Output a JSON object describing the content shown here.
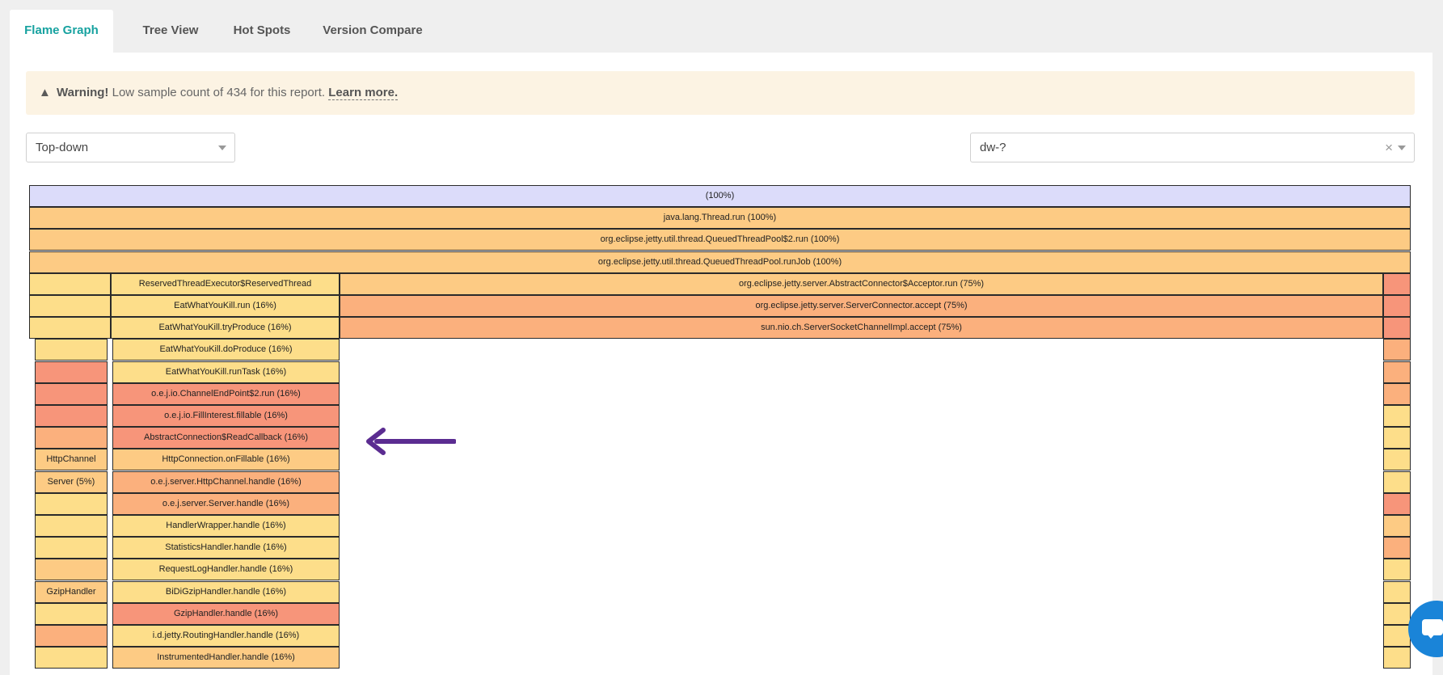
{
  "tabs": [
    {
      "label": "Flame Graph",
      "active": true
    },
    {
      "label": "Tree View",
      "active": false
    },
    {
      "label": "Hot Spots",
      "active": false
    },
    {
      "label": "Version Compare",
      "active": false
    }
  ],
  "warning": {
    "icon": "warning-triangle-icon",
    "strong": "Warning!",
    "message": "Low sample count of 434 for this report.",
    "link": "Learn more."
  },
  "direction_select": {
    "value": "Top-down"
  },
  "filter_select": {
    "value": "dw-?"
  },
  "colors": {
    "root": "#dcdcfa",
    "yellow": "#fdde8a",
    "orange": "#fdcb84",
    "salmon": "#fbb07d",
    "red": "#f7957a",
    "tab_active": "#17a2a0",
    "arrow": "#5b2c91"
  },
  "flame_rows": [
    [
      {
        "t": "(100%)",
        "c": "root"
      }
    ],
    [
      {
        "t": "java.lang.Thread.run (100%)",
        "c": "orange"
      }
    ],
    [
      {
        "t": "org.eclipse.jetty.util.thread.QueuedThreadPool$2.run (100%)",
        "c": "orange"
      }
    ],
    [
      {
        "t": "org.eclipse.jetty.util.thread.QueuedThreadPool.runJob (100%)",
        "c": "orange"
      }
    ],
    [
      {
        "t": "",
        "c": "yellow"
      },
      {
        "t": "ReservedThreadExecutor$ReservedThread",
        "c": "yellow"
      },
      {
        "t": "org.eclipse.jetty.server.AbstractConnector$Acceptor.run (75%)",
        "c": "orange"
      },
      {
        "t": "",
        "c": "red"
      }
    ],
    [
      {
        "t": "",
        "c": "yellow"
      },
      {
        "t": "EatWhatYouKill.run (16%)",
        "c": "yellow"
      },
      {
        "t": "org.eclipse.jetty.server.ServerConnector.accept (75%)",
        "c": "salmon"
      },
      {
        "t": "",
        "c": "red"
      }
    ],
    [
      {
        "t": "",
        "c": "yellow"
      },
      {
        "t": "EatWhatYouKill.tryProduce (16%)",
        "c": "yellow"
      },
      {
        "t": "sun.nio.ch.ServerSocketChannelImpl.accept (75%)",
        "c": "salmon"
      },
      {
        "t": "",
        "c": "red"
      }
    ],
    [
      {
        "t": "",
        "c": "yellow"
      },
      {
        "t": "EatWhatYouKill.doProduce (16%)",
        "c": "yellow"
      },
      {
        "t": "",
        "c": "salmon"
      }
    ],
    [
      {
        "t": "",
        "c": "red"
      },
      {
        "t": "EatWhatYouKill.runTask (16%)",
        "c": "yellow"
      },
      {
        "t": "",
        "c": "salmon"
      }
    ],
    [
      {
        "t": "",
        "c": "red"
      },
      {
        "t": "o.e.j.io.ChannelEndPoint$2.run (16%)",
        "c": "red"
      },
      {
        "t": "",
        "c": "salmon"
      }
    ],
    [
      {
        "t": "",
        "c": "red"
      },
      {
        "t": "o.e.j.io.FillInterest.fillable (16%)",
        "c": "red"
      },
      {
        "t": "",
        "c": "yellow"
      }
    ],
    [
      {
        "t": "",
        "c": "salmon"
      },
      {
        "t": "AbstractConnection$ReadCallback (16%)",
        "c": "red"
      },
      {
        "t": "",
        "c": "yellow"
      }
    ],
    [
      {
        "t": "HttpChannel",
        "c": "orange"
      },
      {
        "t": "HttpConnection.onFillable (16%)",
        "c": "orange"
      },
      {
        "t": "",
        "c": "yellow"
      }
    ],
    [
      {
        "t": "Server (5%)",
        "c": "orange"
      },
      {
        "t": "o.e.j.server.HttpChannel.handle (16%)",
        "c": "salmon"
      },
      {
        "t": "",
        "c": "yellow"
      }
    ],
    [
      {
        "t": "",
        "c": "yellow"
      },
      {
        "t": "o.e.j.server.Server.handle (16%)",
        "c": "salmon"
      },
      {
        "t": "",
        "c": "red"
      }
    ],
    [
      {
        "t": "",
        "c": "yellow"
      },
      {
        "t": "HandlerWrapper.handle (16%)",
        "c": "yellow"
      },
      {
        "t": "",
        "c": "orange"
      }
    ],
    [
      {
        "t": "",
        "c": "yellow"
      },
      {
        "t": "StatisticsHandler.handle (16%)",
        "c": "yellow"
      },
      {
        "t": "",
        "c": "salmon"
      }
    ],
    [
      {
        "t": "",
        "c": "orange"
      },
      {
        "t": "RequestLogHandler.handle (16%)",
        "c": "yellow"
      },
      {
        "t": "",
        "c": "yellow"
      }
    ],
    [
      {
        "t": "GzipHandler",
        "c": "orange"
      },
      {
        "t": "BiDiGzipHandler.handle (16%)",
        "c": "yellow"
      },
      {
        "t": "",
        "c": "yellow"
      }
    ],
    [
      {
        "t": "",
        "c": "yellow"
      },
      {
        "t": "GzipHandler.handle (16%)",
        "c": "red"
      },
      {
        "t": "",
        "c": "yellow"
      }
    ],
    [
      {
        "t": "",
        "c": "salmon"
      },
      {
        "t": "i.d.jetty.RoutingHandler.handle (16%)",
        "c": "yellow"
      },
      {
        "t": "",
        "c": "yellow"
      }
    ],
    [
      {
        "t": "",
        "c": "yellow"
      },
      {
        "t": "InstrumentedHandler.handle (16%)",
        "c": "orange"
      },
      {
        "t": "",
        "c": "yellow"
      }
    ]
  ],
  "chat_button": {
    "icon": "chat-icon"
  }
}
